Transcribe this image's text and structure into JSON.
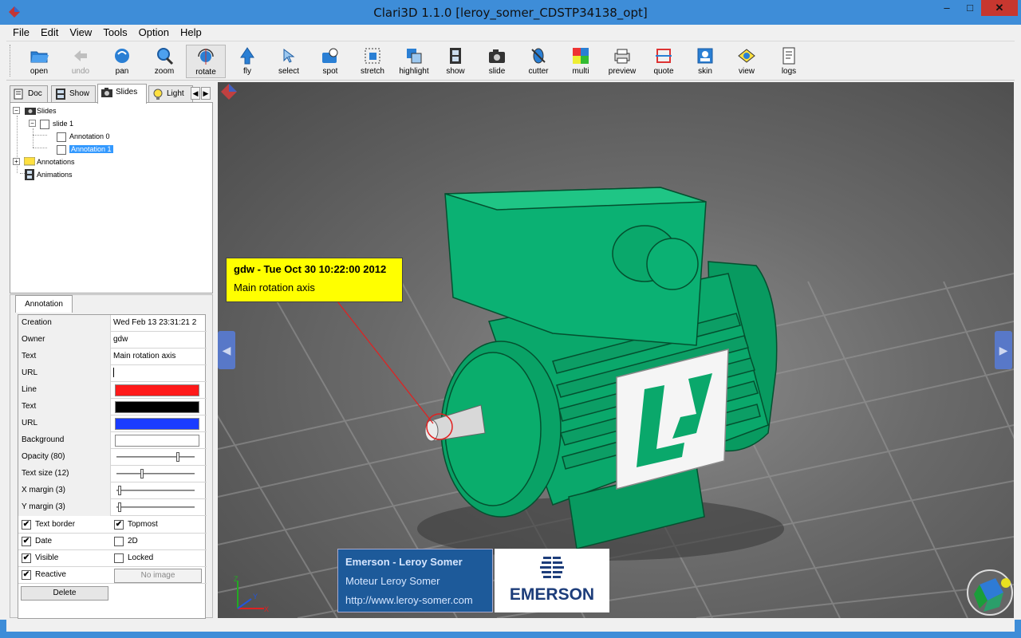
{
  "window": {
    "title": "Clari3D   1.1.0 [leroy_somer_CDSTP34138_opt]",
    "min_glyph": "–",
    "max_glyph": "□",
    "close_glyph": "✕"
  },
  "menu": [
    "File",
    "Edit",
    "View",
    "Tools",
    "Option",
    "Help"
  ],
  "toolbar": [
    {
      "label": "open",
      "icon": "folder-open-icon"
    },
    {
      "label": "undo",
      "icon": "undo-arrow-icon",
      "disabled": true
    },
    {
      "label": "pan",
      "icon": "pan-hand-icon"
    },
    {
      "label": "zoom",
      "icon": "zoom-magnifier-icon"
    },
    {
      "label": "rotate",
      "icon": "rotate-icon",
      "active": true
    },
    {
      "label": "fly",
      "icon": "fly-arrow-icon"
    },
    {
      "label": "select",
      "icon": "select-cursor-icon"
    },
    {
      "label": "spot",
      "icon": "spot-icon"
    },
    {
      "label": "stretch",
      "icon": "stretch-icon"
    },
    {
      "label": "highlight",
      "icon": "highlight-icon"
    },
    {
      "label": "show",
      "icon": "film-show-icon"
    },
    {
      "label": "slide",
      "icon": "camera-slide-icon"
    },
    {
      "label": "cutter",
      "icon": "cutter-icon"
    },
    {
      "label": "multi",
      "icon": "multi-color-icon"
    },
    {
      "label": "preview",
      "icon": "printer-preview-icon"
    },
    {
      "label": "quote",
      "icon": "quote-dimension-icon"
    },
    {
      "label": "skin",
      "icon": "skin-icon"
    },
    {
      "label": "view",
      "icon": "view-eye-icon"
    },
    {
      "label": "logs",
      "icon": "logs-document-icon"
    }
  ],
  "tabs": [
    {
      "label": "Doc",
      "icon": "doc-icon"
    },
    {
      "label": "Show",
      "icon": "film-icon"
    },
    {
      "label": "Slides",
      "icon": "camera-icon",
      "selected": true
    },
    {
      "label": "Light",
      "icon": "bulb-icon"
    }
  ],
  "tree": {
    "slides": "Slides",
    "slide1": "slide 1",
    "annotation0": "Annotation 0",
    "annotation1": "Annotation 1",
    "annotations": "Annotations",
    "animations": "Animations"
  },
  "annotation_panel": {
    "tab": "Annotation",
    "creation_label": "Creation",
    "creation_value": "Wed Feb 13 23:31:21 2",
    "owner_label": "Owner",
    "owner_value": "gdw",
    "text_label": "Text",
    "text_value": "Main rotation axis",
    "url_label": "URL",
    "url_value": "",
    "line_label": "Line",
    "line_color": "#ff1a1a",
    "textcolor_label": "Text",
    "text_color": "#000000",
    "urlcolor_label": "URL",
    "url_color": "#1a3cff",
    "background_label": "Background",
    "background_color": "#ffffff",
    "opacity_label": "Opacity (80)",
    "opacity_value": 80,
    "textsize_label": "Text size (12)",
    "textsize_fraction": 0.32,
    "xmargin_label": "X margin (3)",
    "xmargin_fraction": 0.02,
    "ymargin_label": "Y margin (3)",
    "ymargin_fraction": 0.02,
    "text_border_label": "Text border",
    "text_border": true,
    "topmost_label": "Topmost",
    "topmost": true,
    "date_label": "Date",
    "date": true,
    "twod_label": "2D",
    "twod": false,
    "visible_label": "Visible",
    "visible": true,
    "locked_label": "Locked",
    "locked": false,
    "reactive_label": "Reactive",
    "reactive": true,
    "no_image_label": "No image",
    "delete_label": "Delete"
  },
  "viewport": {
    "annotation_title": "gdw - Tue Oct 30 10:22:00 2012",
    "annotation_text": "Main rotation axis",
    "company_line1": "Emerson - Leroy Somer",
    "company_line2": "Moteur Leroy Somer",
    "company_line3": "http://www.leroy-somer.com",
    "logo_text": "EMERSON",
    "nav_left": "◀",
    "nav_right": "▶",
    "motor_color": "#0aa86b",
    "axis_labels": {
      "z": "Z",
      "y": "Y",
      "x": "X"
    }
  }
}
